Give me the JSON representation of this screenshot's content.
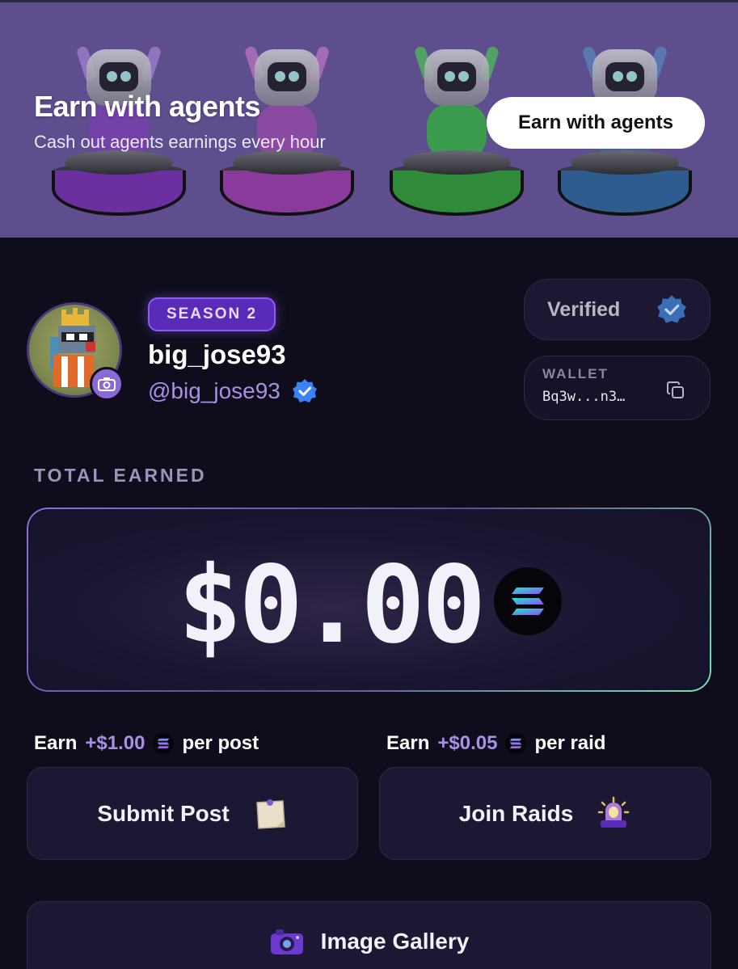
{
  "banner": {
    "title": "Earn with agents",
    "subtitle": "Cash out agents earnings every hour",
    "button_label": "Earn with agents",
    "robot_colors": [
      "#7b3fb0",
      "#8a3a9a",
      "#2f8a3a",
      "#2f5c8f"
    ]
  },
  "profile": {
    "season_badge": "SEASON 2",
    "username": "big_jose93",
    "handle": "@big_jose93",
    "verified_label": "Verified",
    "wallet_label": "WALLET",
    "wallet_address": "Bq3w...n3…"
  },
  "earnings": {
    "section_label": "TOTAL EARNED",
    "total": "$0.00",
    "post_reward": {
      "prefix": "Earn",
      "amount": "+$1.00",
      "suffix": "per post"
    },
    "raid_reward": {
      "prefix": "Earn",
      "amount": "+$0.05",
      "suffix": "per raid"
    }
  },
  "actions": {
    "submit_post": "Submit Post",
    "join_raids": "Join Raids",
    "image_gallery": "Image Gallery"
  },
  "colors": {
    "accent": "#8b5cf6",
    "handle": "#a98fe6",
    "verified_blue": "#3b82f6",
    "background": "#0f0d1c"
  }
}
